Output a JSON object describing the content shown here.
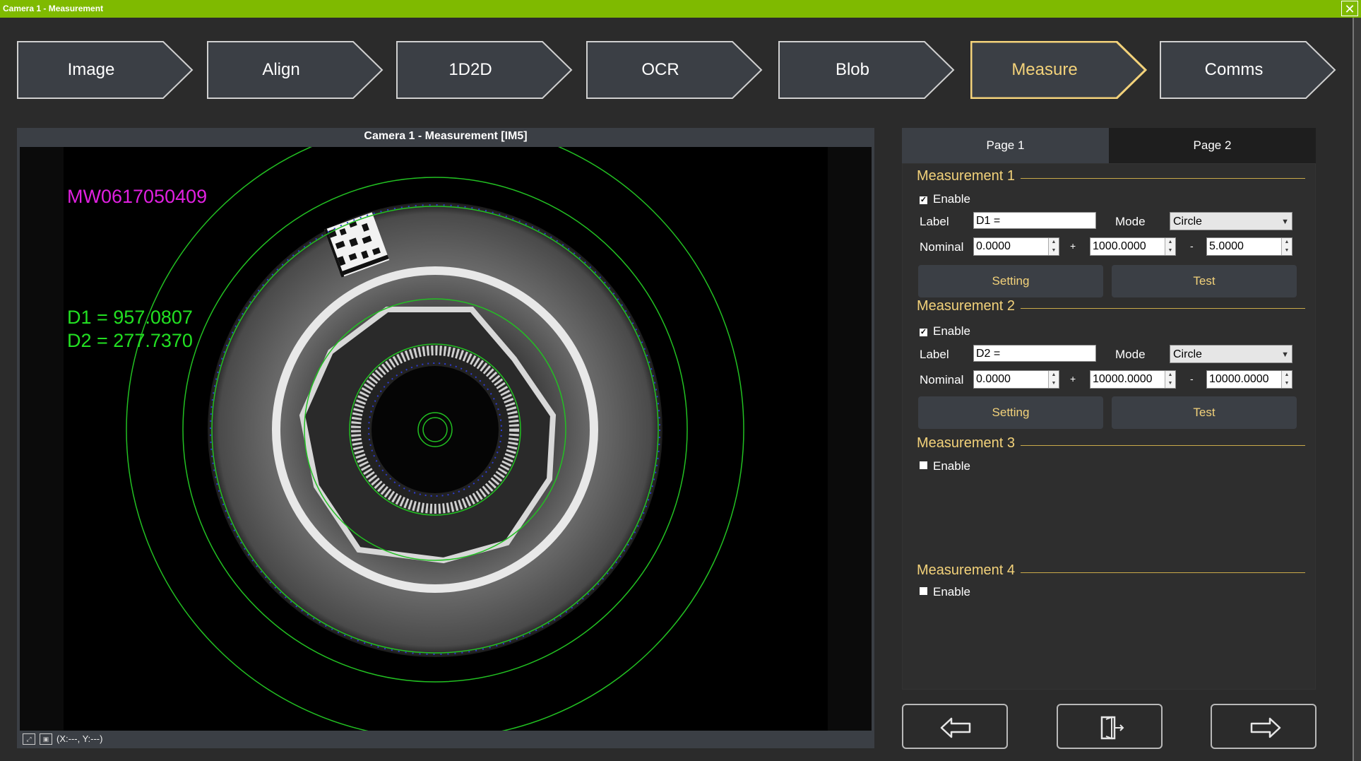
{
  "window": {
    "title": "Camera 1 - Measurement"
  },
  "steps": [
    {
      "label": "Image",
      "active": false
    },
    {
      "label": "Align",
      "active": false
    },
    {
      "label": "1D2D",
      "active": false
    },
    {
      "label": "OCR",
      "active": false
    },
    {
      "label": "Blob",
      "active": false
    },
    {
      "label": "Measure",
      "active": true
    },
    {
      "label": "Comms",
      "active": false
    }
  ],
  "image_panel": {
    "caption": "Camera 1 -  Measurement  [IM5]",
    "overlay_id": "MW0617050409",
    "overlay_d1": "D1 = 957.0807",
    "overlay_d2": "D2 = 277.7370",
    "status_coords": "(X:---, Y:---)"
  },
  "tabs": [
    {
      "label": "Page 1",
      "active": true
    },
    {
      "label": "Page 2",
      "active": false
    }
  ],
  "measurements": [
    {
      "title": "Measurement 1",
      "enable_label": "Enable",
      "enabled": true,
      "label_caption": "Label",
      "label_value": "D1 =",
      "mode_caption": "Mode",
      "mode_value": "Circle",
      "nominal_caption": "Nominal",
      "nominal": "0.0000",
      "plus_sign": "+",
      "plus_tol": "1000.0000",
      "minus_sign": "-",
      "minus_tol": "5.0000",
      "setting_label": "Setting",
      "test_label": "Test"
    },
    {
      "title": "Measurement 2",
      "enable_label": "Enable",
      "enabled": true,
      "label_caption": "Label",
      "label_value": "D2 =",
      "mode_caption": "Mode",
      "mode_value": "Circle",
      "nominal_caption": "Nominal",
      "nominal": "0.0000",
      "plus_sign": "+",
      "plus_tol": "10000.0000",
      "minus_sign": "-",
      "minus_tol": "10000.0000",
      "setting_label": "Setting",
      "test_label": "Test"
    },
    {
      "title": "Measurement 3",
      "enable_label": "Enable",
      "enabled": false
    },
    {
      "title": "Measurement 4",
      "enable_label": "Enable",
      "enabled": false
    }
  ],
  "nav": {
    "back_icon": "arrow-left-icon",
    "exit_icon": "exit-door-icon",
    "next_icon": "arrow-right-icon"
  },
  "colors": {
    "titlebar": "#7fba00",
    "accent": "#f3d27a",
    "overlay_green": "#22e022",
    "overlay_magenta": "#e020e0"
  }
}
